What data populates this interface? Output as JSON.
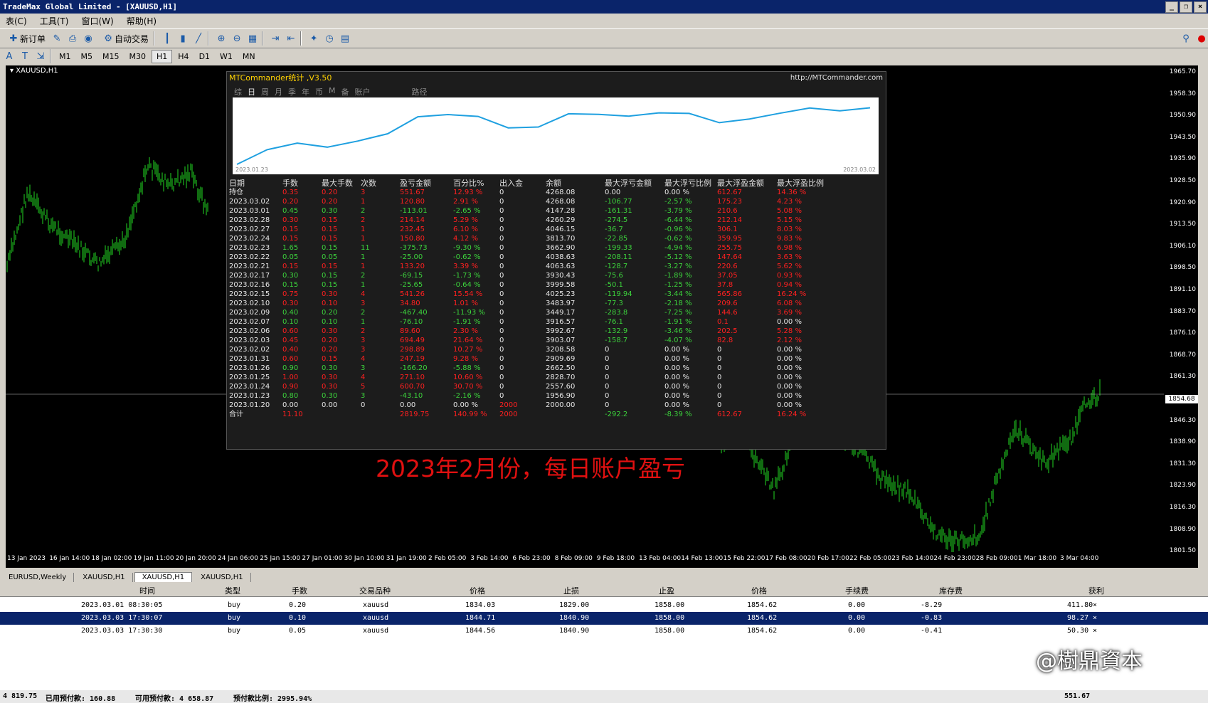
{
  "window": {
    "title": "TradeMax Global Limited - [XAUUSD,H1]",
    "min": "_",
    "restore": "❐",
    "close": "×"
  },
  "menu": [
    "表(C)",
    "工具(T)",
    "窗口(W)",
    "帮助(H)"
  ],
  "toolbar": {
    "new_order": "新订单",
    "auto_trade": "自动交易"
  },
  "timeframes": [
    "M1",
    "M5",
    "M15",
    "M30",
    "H1",
    "H4",
    "D1",
    "W1",
    "MN"
  ],
  "active_timeframe": "H1",
  "chart": {
    "symbol_label": "▾ XAUUSD,H1",
    "price_labels": [
      "1965.70",
      "1958.30",
      "1950.90",
      "1943.50",
      "1935.90",
      "1928.50",
      "1920.90",
      "1913.50",
      "1906.10",
      "1898.50",
      "1891.10",
      "1883.70",
      "1876.10",
      "1868.70",
      "1861.30",
      "1854.68",
      "1846.30",
      "1838.90",
      "1831.30",
      "1823.90",
      "1816.30",
      "1808.90",
      "1801.50"
    ],
    "current_price": "1854.68",
    "time_labels": [
      "13 Jan 2023",
      "16 Jan 14:00",
      "18 Jan 02:00",
      "19 Jan 11:00",
      "20 Jan 20:00",
      "24 Jan 06:00",
      "25 Jan 15:00",
      "27 Jan 01:00",
      "30 Jan 10:00",
      "31 Jan 19:00",
      "2 Feb 05:00",
      "3 Feb 14:00",
      "6 Feb 23:00",
      "8 Feb 09:00",
      "9 Feb 18:00",
      "13 Feb 04:00",
      "14 Feb 13:00",
      "15 Feb 22:00",
      "17 Feb 08:00",
      "20 Feb 17:00",
      "22 Feb 05:00",
      "23 Feb 14:00",
      "24 Feb 23:00",
      "28 Feb 09:00",
      "1 Mar 18:00",
      "3 Mar 04:00"
    ],
    "annotation": "2023年2月份，每日账户盈亏",
    "colors": {
      "background": "#000000",
      "candle": "#1db31d",
      "bid_line": "#c0c0c0"
    }
  },
  "mtc": {
    "title": "MTCommander统计 ,V3.50",
    "url": "http://MTCommander.com",
    "tabs": [
      "综",
      "日",
      "周",
      "月",
      "季",
      "年",
      "币",
      "M",
      "备",
      "账户"
    ],
    "active_tab": "日",
    "extra_tab": "路径",
    "mini_start": "2023.01.23",
    "mini_end": "2023.03.02",
    "headers": [
      "日期",
      "手数",
      "最大手数",
      "次数",
      "盈亏金额",
      "百分比%",
      "出入金",
      "余额",
      "最大浮亏金额",
      "最大浮亏比例",
      "最大浮盈金额",
      "最大浮盈比例"
    ],
    "rows": [
      [
        "持仓",
        "0.35",
        "0.20",
        "3",
        "551.67",
        "12.93 %",
        "0",
        "4268.08",
        "0.00",
        "0.00 %",
        "612.67",
        "14.36 %"
      ],
      [
        "2023.03.02",
        "0.20",
        "0.20",
        "1",
        "120.80",
        "2.91 %",
        "0",
        "4268.08",
        "-106.77",
        "-2.57 %",
        "175.23",
        "4.23 %"
      ],
      [
        "2023.03.01",
        "0.45",
        "0.30",
        "2",
        "-113.01",
        "-2.65 %",
        "0",
        "4147.28",
        "-161.31",
        "-3.79 %",
        "210.6",
        "5.08 %"
      ],
      [
        "2023.02.28",
        "0.30",
        "0.15",
        "2",
        "214.14",
        "5.29 %",
        "0",
        "4260.29",
        "-274.5",
        "-6.44 %",
        "212.14",
        "5.15 %"
      ],
      [
        "2023.02.27",
        "0.15",
        "0.15",
        "1",
        "232.45",
        "6.10 %",
        "0",
        "4046.15",
        "-36.7",
        "-0.96 %",
        "306.1",
        "8.03 %"
      ],
      [
        "2023.02.24",
        "0.15",
        "0.15",
        "1",
        "150.80",
        "4.12 %",
        "0",
        "3813.70",
        "-22.85",
        "-0.62 %",
        "359.95",
        "9.83 %"
      ],
      [
        "2023.02.23",
        "1.65",
        "0.15",
        "11",
        "-375.73",
        "-9.30 %",
        "0",
        "3662.90",
        "-199.33",
        "-4.94 %",
        "255.75",
        "6.98 %"
      ],
      [
        "2023.02.22",
        "0.05",
        "0.05",
        "1",
        "-25.00",
        "-0.62 %",
        "0",
        "4038.63",
        "-208.11",
        "-5.12 %",
        "147.64",
        "3.63 %"
      ],
      [
        "2023.02.21",
        "0.15",
        "0.15",
        "1",
        "133.20",
        "3.39 %",
        "0",
        "4063.63",
        "-128.7",
        "-3.27 %",
        "220.6",
        "5.62 %"
      ],
      [
        "2023.02.17",
        "0.30",
        "0.15",
        "2",
        "-69.15",
        "-1.73 %",
        "0",
        "3930.43",
        "-75.6",
        "-1.89 %",
        "37.05",
        "0.93 %"
      ],
      [
        "2023.02.16",
        "0.15",
        "0.15",
        "1",
        "-25.65",
        "-0.64 %",
        "0",
        "3999.58",
        "-50.1",
        "-1.25 %",
        "37.8",
        "0.94 %"
      ],
      [
        "2023.02.15",
        "0.75",
        "0.30",
        "4",
        "541.26",
        "15.54 %",
        "0",
        "4025.23",
        "-119.94",
        "-3.44 %",
        "565.86",
        "16.24 %"
      ],
      [
        "2023.02.10",
        "0.30",
        "0.10",
        "3",
        "34.80",
        "1.01 %",
        "0",
        "3483.97",
        "-77.3",
        "-2.18 %",
        "209.6",
        "6.08 %"
      ],
      [
        "2023.02.09",
        "0.40",
        "0.20",
        "2",
        "-467.40",
        "-11.93 %",
        "0",
        "3449.17",
        "-283.8",
        "-7.25 %",
        "144.6",
        "3.69 %"
      ],
      [
        "2023.02.07",
        "0.10",
        "0.10",
        "1",
        "-76.10",
        "-1.91 %",
        "0",
        "3916.57",
        "-76.1",
        "-1.91 %",
        "0.1",
        "0.00 %"
      ],
      [
        "2023.02.06",
        "0.60",
        "0.30",
        "2",
        "89.60",
        "2.30 %",
        "0",
        "3992.67",
        "-132.9",
        "-3.46 %",
        "202.5",
        "5.28 %"
      ],
      [
        "2023.02.03",
        "0.45",
        "0.20",
        "3",
        "694.49",
        "21.64 %",
        "0",
        "3903.07",
        "-158.7",
        "-4.07 %",
        "82.8",
        "2.12 %"
      ],
      [
        "2023.02.02",
        "0.40",
        "0.20",
        "3",
        "298.89",
        "10.27 %",
        "0",
        "3208.58",
        "0",
        "0.00 %",
        "0",
        "0.00 %"
      ],
      [
        "2023.01.31",
        "0.60",
        "0.15",
        "4",
        "247.19",
        "9.28 %",
        "0",
        "2909.69",
        "0",
        "0.00 %",
        "0",
        "0.00 %"
      ],
      [
        "2023.01.26",
        "0.90",
        "0.30",
        "3",
        "-166.20",
        "-5.88 %",
        "0",
        "2662.50",
        "0",
        "0.00 %",
        "0",
        "0.00 %"
      ],
      [
        "2023.01.25",
        "1.00",
        "0.30",
        "4",
        "271.10",
        "10.60 %",
        "0",
        "2828.70",
        "0",
        "0.00 %",
        "0",
        "0.00 %"
      ],
      [
        "2023.01.24",
        "0.90",
        "0.30",
        "5",
        "600.70",
        "30.70 %",
        "0",
        "2557.60",
        "0",
        "0.00 %",
        "0",
        "0.00 %"
      ],
      [
        "2023.01.23",
        "0.80",
        "0.30",
        "3",
        "-43.10",
        "-2.16 %",
        "0",
        "1956.90",
        "0",
        "0.00 %",
        "0",
        "0.00 %"
      ],
      [
        "2023.01.20",
        "0.00",
        "0.00",
        "0",
        "0.00",
        "0.00 %",
        "2000",
        "2000.00",
        "0",
        "0.00 %",
        "0",
        "0.00 %"
      ]
    ],
    "total": [
      "合计",
      "11.10",
      "",
      "",
      "2819.75",
      "140.99 %",
      "2000",
      "",
      "-292.2",
      "-8.39 %",
      "612.67",
      "16.24 %"
    ]
  },
  "chart_tabs": [
    "EURUSD,Weekly",
    "XAUUSD,H1",
    "XAUUSD,H1",
    "XAUUSD,H1"
  ],
  "active_chart_tab": 2,
  "terminal": {
    "headers": [
      "时间",
      "类型",
      "手数",
      "交易品种",
      "价格",
      "止损",
      "止盈",
      "价格",
      "手续费",
      "库存费",
      "获利"
    ],
    "rows": [
      [
        "2023.03.01 08:30:05",
        "buy",
        "0.20",
        "xauusd",
        "1834.03",
        "1829.00",
        "1858.00",
        "1854.62",
        "0.00",
        "-8.29",
        "411.80"
      ],
      [
        "2023.03.03 17:30:07",
        "buy",
        "0.10",
        "xauusd",
        "1844.71",
        "1840.90",
        "1858.00",
        "1854.62",
        "0.00",
        "-0.83",
        "98.27"
      ],
      [
        "2023.03.03 17:30:30",
        "buy",
        "0.05",
        "xauusd",
        "1844.56",
        "1840.90",
        "1858.00",
        "1854.62",
        "0.00",
        "-0.41",
        "50.30"
      ]
    ],
    "selected_row": 1,
    "summary": {
      "left": "4 819.75",
      "used": "已用预付款: 160.88",
      "free": "可用预付款: 4 658.87",
      "ratio": "预付款比例: 2995.94%",
      "profit": "551.67"
    }
  },
  "watermark": "@樹鼎資本"
}
